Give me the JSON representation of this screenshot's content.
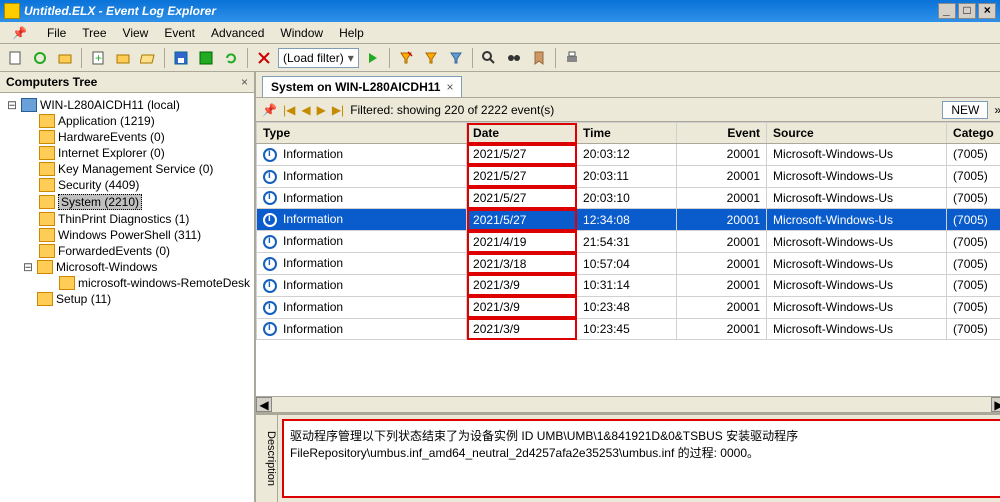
{
  "window": {
    "title": "Untitled.ELX - Event Log Explorer",
    "buttons": [
      "_",
      "□",
      "×"
    ]
  },
  "menu": [
    "File",
    "Tree",
    "View",
    "Event",
    "Advanced",
    "Window",
    "Help"
  ],
  "toolbar": {
    "filter_label": "(Load filter)"
  },
  "tree": {
    "title": "Computers Tree",
    "root": "WIN-L280AICDH11 (local)",
    "items": [
      "Application (1219)",
      "HardwareEvents (0)",
      "Internet Explorer (0)",
      "Key Management Service (0)",
      "Security (4409)",
      "System (2210)",
      "ThinPrint Diagnostics (1)",
      "Windows PowerShell (311)",
      "ForwardedEvents (0)"
    ],
    "selected_index": 5,
    "sub": {
      "name": "Microsoft-Windows",
      "children": [
        "microsoft-windows-RemoteDesk"
      ]
    },
    "last": "Setup (11)"
  },
  "tab": {
    "label": "System on WIN-L280AICDH11",
    "close": "×"
  },
  "grid_toolbar": {
    "status": "Filtered: showing 220 of 2222 event(s)",
    "new_btn": "NEW"
  },
  "columns": [
    "Type",
    "Date",
    "Time",
    "Event",
    "Source",
    "Catego"
  ],
  "rows": [
    {
      "type": "Information",
      "date": "2021/5/27",
      "time": "20:03:12",
      "event": "20001",
      "source": "Microsoft-Windows-Us",
      "cat": "(7005)",
      "sel": false
    },
    {
      "type": "Information",
      "date": "2021/5/27",
      "time": "20:03:11",
      "event": "20001",
      "source": "Microsoft-Windows-Us",
      "cat": "(7005)",
      "sel": false
    },
    {
      "type": "Information",
      "date": "2021/5/27",
      "time": "20:03:10",
      "event": "20001",
      "source": "Microsoft-Windows-Us",
      "cat": "(7005)",
      "sel": false
    },
    {
      "type": "Information",
      "date": "2021/5/27",
      "time": "12:34:08",
      "event": "20001",
      "source": "Microsoft-Windows-Us",
      "cat": "(7005)",
      "sel": true
    },
    {
      "type": "Information",
      "date": "2021/4/19",
      "time": "21:54:31",
      "event": "20001",
      "source": "Microsoft-Windows-Us",
      "cat": "(7005)",
      "sel": false
    },
    {
      "type": "Information",
      "date": "2021/3/18",
      "time": "10:57:04",
      "event": "20001",
      "source": "Microsoft-Windows-Us",
      "cat": "(7005)",
      "sel": false
    },
    {
      "type": "Information",
      "date": "2021/3/9",
      "time": "10:31:14",
      "event": "20001",
      "source": "Microsoft-Windows-Us",
      "cat": "(7005)",
      "sel": false
    },
    {
      "type": "Information",
      "date": "2021/3/9",
      "time": "10:23:48",
      "event": "20001",
      "source": "Microsoft-Windows-Us",
      "cat": "(7005)",
      "sel": false
    },
    {
      "type": "Information",
      "date": "2021/3/9",
      "time": "10:23:45",
      "event": "20001",
      "source": "Microsoft-Windows-Us",
      "cat": "(7005)",
      "sel": false
    }
  ],
  "description": {
    "tab": "Description",
    "text": "驱动程序管理以下列状态结束了为设备实例 ID UMB\\UMB\\1&841921D&0&TSBUS 安装驱动程序 FileRepository\\umbus.inf_amd64_neutral_2d4257afa2e35253\\umbus.inf 的过程: 0000。"
  }
}
